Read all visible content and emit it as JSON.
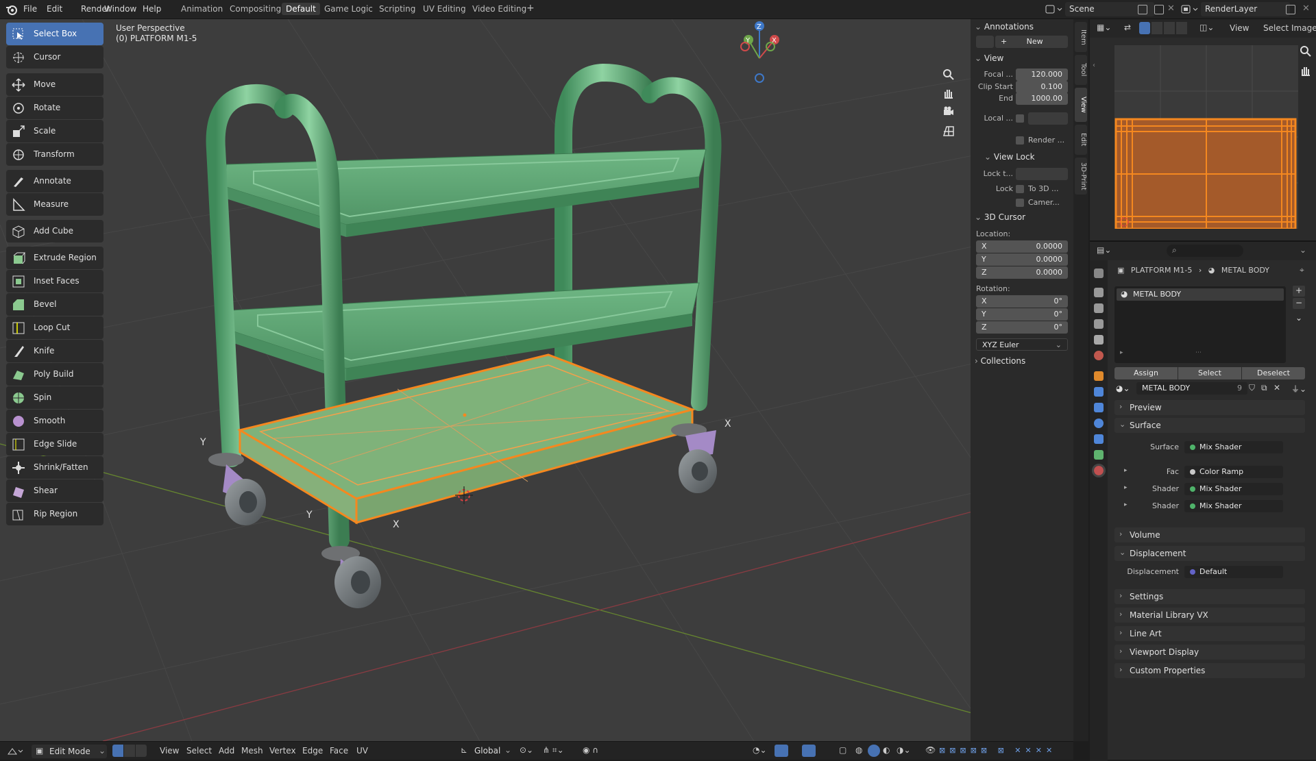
{
  "menu": {
    "file": "File",
    "edit": "Edit",
    "render": "Render",
    "window": "Window",
    "help": "Help"
  },
  "workspaces": [
    "Animation",
    "Compositing",
    "Default",
    "Game Logic",
    "Scripting",
    "UV Editing",
    "Video Editing"
  ],
  "active_workspace": "Default",
  "scene": {
    "label": "Scene",
    "render_layer": "RenderLayer"
  },
  "viewport": {
    "perspective": "User Perspective",
    "object_name": "(0) PLATFORM M1-5",
    "axis_labels": {
      "x": "X",
      "y": "Y"
    }
  },
  "tools": [
    "Select Box",
    "Cursor",
    "Move",
    "Rotate",
    "Scale",
    "Transform",
    "Annotate",
    "Measure",
    "Add Cube",
    "Extrude Region",
    "Inset Faces",
    "Bevel",
    "Loop Cut",
    "Knife",
    "Poly Build",
    "Spin",
    "Smooth",
    "Edge Slide",
    "Shrink/Fatten",
    "Shear",
    "Rip Region"
  ],
  "active_tool": "Select Box",
  "npanel": {
    "tabs": [
      "Item",
      "Tool",
      "View",
      "Edit",
      "3D-Print"
    ],
    "active_tab": "View",
    "annotations": {
      "title": "Annotations",
      "new_label": "New"
    },
    "view": {
      "title": "View",
      "focal_label": "Focal ...",
      "focal_value": "120.000",
      "clip_start_label": "Clip Start",
      "clip_start_value": "0.100",
      "end_label": "End",
      "end_value": "1000.00",
      "local_label": "Local ...",
      "render_label": "Render ..."
    },
    "view_lock": {
      "title": "View Lock",
      "lock_t_label": "Lock t...",
      "lock_label": "Lock",
      "to3d_label": "To 3D ...",
      "camera_label": "Camer..."
    },
    "cursor": {
      "title": "3D Cursor",
      "location_label": "Location:",
      "loc": [
        {
          "axis": "X",
          "value": "0.0000"
        },
        {
          "axis": "Y",
          "value": "0.0000"
        },
        {
          "axis": "Z",
          "value": "0.0000"
        }
      ],
      "rotation_label": "Rotation:",
      "rot": [
        {
          "axis": "X",
          "value": "0°"
        },
        {
          "axis": "Y",
          "value": "0°"
        },
        {
          "axis": "Z",
          "value": "0°"
        }
      ],
      "euler": "XYZ Euler"
    },
    "collections": "Collections"
  },
  "uv_header": {
    "view": "View",
    "select": "Select",
    "image": "Image"
  },
  "properties": {
    "breadcrumb_object": "PLATFORM M1-5",
    "breadcrumb_material": "METAL BODY",
    "slot_name": "METAL  BODY",
    "assign": "Assign",
    "select": "Select",
    "deselect": "Deselect",
    "material_name": "METAL  BODY",
    "users": "9",
    "sections": {
      "preview": "Preview",
      "surface": "Surface",
      "volume": "Volume",
      "displacement": "Displacement",
      "settings": "Settings",
      "material_library": "Material Library VX",
      "line_art": "Line Art",
      "viewport_display": "Viewport Display",
      "custom_properties": "Custom Properties"
    },
    "surface_rows": [
      {
        "label": "Surface",
        "value": "Mix Shader"
      },
      {
        "label": "Fac",
        "value": "Color Ramp"
      },
      {
        "label": "Shader",
        "value": "Mix Shader"
      },
      {
        "label": "Shader",
        "value": "Mix Shader"
      }
    ],
    "displacement_row": {
      "label": "Displacement",
      "value": "Default"
    }
  },
  "bottom_bar": {
    "mode": "Edit Mode",
    "menus": [
      "View",
      "Select",
      "Add",
      "Mesh",
      "Vertex",
      "Edge",
      "Face",
      "UV"
    ],
    "orientation": "Global"
  },
  "colors": {
    "accent": "#4772b3",
    "cart_green": "#5fa874",
    "selection_orange": "#f5881f",
    "shader_dot": "#4fb36a",
    "displacement_dot": "#6363c7"
  }
}
